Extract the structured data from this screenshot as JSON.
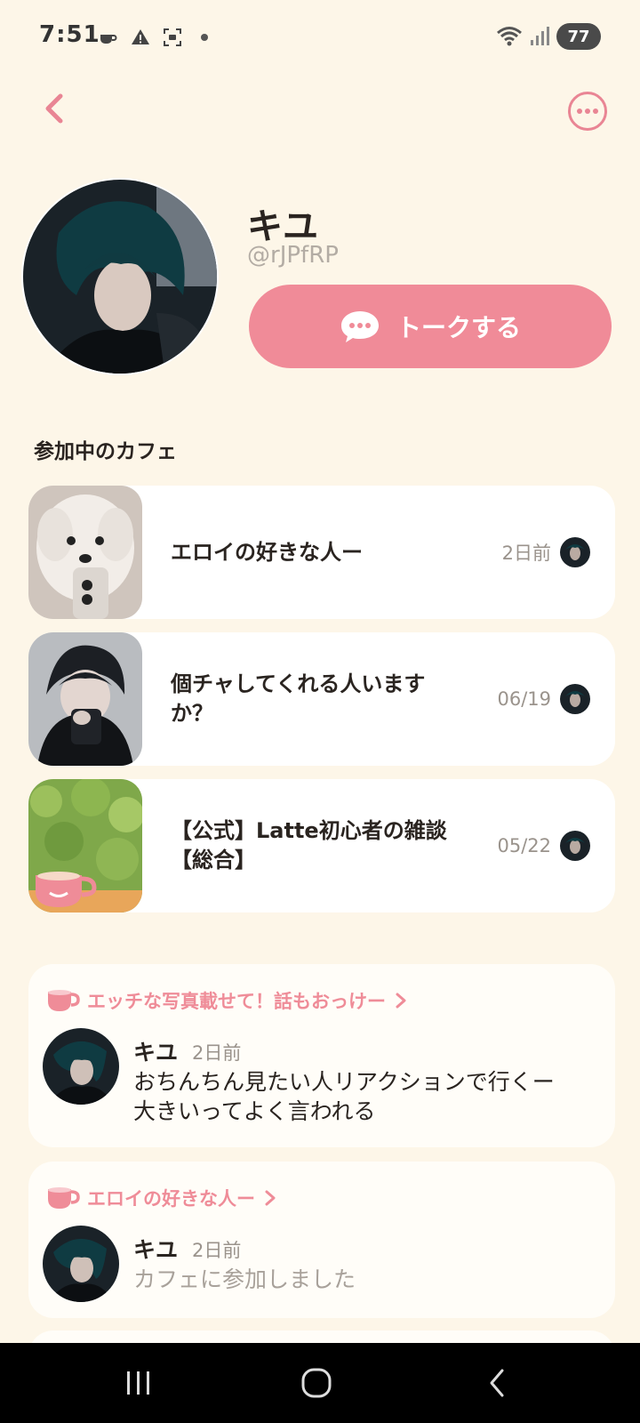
{
  "status_bar": {
    "time": "7:51",
    "battery": "77",
    "icons": [
      "coffee-icon",
      "warning-icon",
      "screenshot-icon",
      "dot-icon",
      "wifi-icon",
      "signal-icon"
    ]
  },
  "header": {
    "back_icon": "chevron-left-icon",
    "more_icon": "more-horizontal-icon"
  },
  "profile": {
    "name": "キユ",
    "handle": "@rJPfRP",
    "talk_button_label": "トークする"
  },
  "joined_cafes": {
    "title": "参加中のカフェ",
    "items": [
      {
        "title": "エロイの好きな人ー",
        "date": "2日前"
      },
      {
        "title": "個チャしてくれる人いますか？",
        "date": "06/19"
      },
      {
        "title": "【公式】Latte初心者の雑談【総合】",
        "date": "05/22"
      }
    ]
  },
  "activity": [
    {
      "cafe_name": "エッチな写真載せて！話もおっけー",
      "user": "キユ",
      "time": "2日前",
      "text": "おちんちん見たい人リアクションで行くー\n大きいってよく言われる"
    },
    {
      "cafe_name": "エロイの好きな人ー",
      "user": "キユ",
      "time": "2日前",
      "text": "カフェに参加しました"
    }
  ],
  "colors": {
    "background": "#fdf6e8",
    "accent_pink": "#f08b98",
    "card": "#ffffff"
  }
}
